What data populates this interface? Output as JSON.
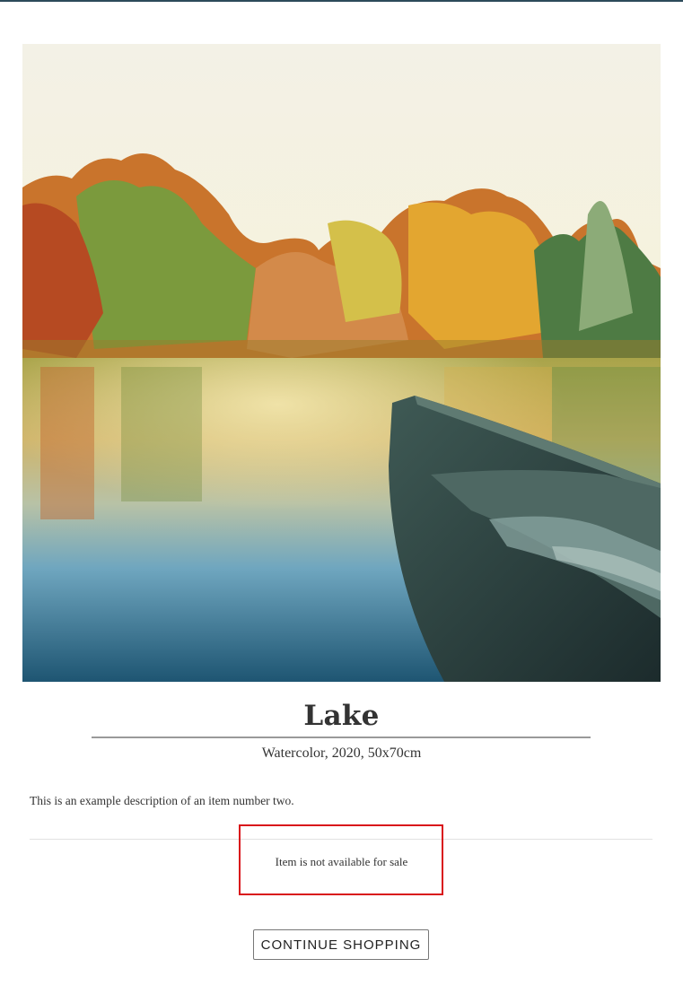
{
  "product": {
    "title": "Lake",
    "subtitle": "Watercolor, 2020, 50x70cm",
    "description": "This is an example description of an item number two.",
    "availability": "Item is not available for sale",
    "continue_label": "CONTINUE SHOPPING"
  },
  "colors": {
    "top_bar": "#2c4a5a",
    "highlight_box": "#d9141b",
    "text": "#333333"
  }
}
